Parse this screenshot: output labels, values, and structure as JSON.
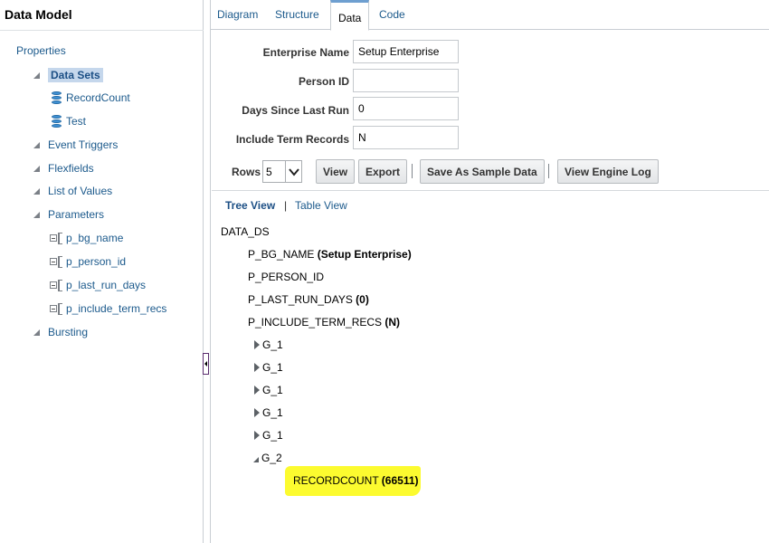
{
  "left_panel": {
    "title": "Data Model",
    "properties": "Properties",
    "data_sets": "Data Sets",
    "data_set_items": [
      "RecordCount",
      "Test"
    ],
    "event_triggers": "Event Triggers",
    "flexfields": "Flexfields",
    "list_of_values": "List of Values",
    "parameters": "Parameters",
    "parameter_items": [
      "p_bg_name",
      "p_person_id",
      "p_last_run_days",
      "p_include_term_recs"
    ],
    "bursting": "Bursting"
  },
  "tabs": [
    "Diagram",
    "Structure",
    "Data",
    "Code"
  ],
  "active_tab": "Data",
  "form": {
    "enterprise_name": {
      "label": "Enterprise Name",
      "value": "Setup Enterprise"
    },
    "person_id": {
      "label": "Person ID",
      "value": ""
    },
    "days_since_last_run": {
      "label": "Days Since Last Run",
      "value": "0"
    },
    "include_term_records": {
      "label": "Include Term Records",
      "value": "N"
    }
  },
  "toolbar": {
    "rows_label": "Rows",
    "rows_value": "5",
    "view_button": "View",
    "export_button": "Export",
    "save_sample_button": "Save As Sample Data",
    "view_engine_log_button": "View Engine Log"
  },
  "views": {
    "tree_view": "Tree View",
    "separator": "|",
    "table_view": "Table View"
  },
  "data_tree": {
    "root": "DATA_DS",
    "params": [
      {
        "name": "P_BG_NAME",
        "value": "(Setup Enterprise)"
      },
      {
        "name": "P_PERSON_ID",
        "value": ""
      },
      {
        "name": "P_LAST_RUN_DAYS",
        "value": "(0)"
      },
      {
        "name": "P_INCLUDE_TERM_RECS",
        "value": "(N)"
      }
    ],
    "groups": [
      "G_1",
      "G_1",
      "G_1",
      "G_1",
      "G_1"
    ],
    "expanded_group": "G_2",
    "leaf": {
      "name": "RECORDCOUNT",
      "value": "(66511)"
    }
  },
  "colors": {
    "link": "#1c5a8c",
    "selected_bg": "#c5d7ec",
    "highlight": "#fcfb2f"
  }
}
